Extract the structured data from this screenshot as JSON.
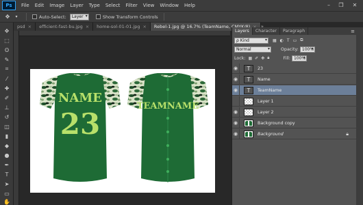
{
  "app": {
    "logo": "Ps"
  },
  "menu": [
    "File",
    "Edit",
    "Image",
    "Layer",
    "Type",
    "Select",
    "Filter",
    "View",
    "Window",
    "Help"
  ],
  "window_controls": {
    "minimize": "–",
    "restore": "❐",
    "close": "✕"
  },
  "options": {
    "auto_select_label": "Auto-Select:",
    "auto_select_value": "Layer",
    "transform_label": "Show Transform Controls"
  },
  "tabs": [
    {
      "label": "psd"
    },
    {
      "label": "efficient-fast-bu.jpg"
    },
    {
      "label": "home-sol-01-01.jpg"
    },
    {
      "label": "Rebel-1.jpg @ 16.7% (TeamName, CMYK/8)"
    }
  ],
  "tab_close": "×",
  "tab_overflow": "»",
  "panel": {
    "tabs": [
      "Layers",
      "Character",
      "Paragraph"
    ],
    "kind_label": "ρ Kind",
    "blend_mode": "Normal",
    "opacity_label": "Opacity:",
    "opacity_value": "100%",
    "lock_label": "Lock:",
    "fill_label": "Fill:",
    "fill_value": "100%",
    "layers": [
      {
        "name": "23",
        "type": "text",
        "visible": true,
        "selected": false
      },
      {
        "name": "Name",
        "type": "text",
        "visible": true,
        "selected": false
      },
      {
        "name": "TeamName",
        "type": "text",
        "visible": true,
        "selected": true
      },
      {
        "name": "Layer 1",
        "type": "pixel",
        "visible": false,
        "selected": false
      },
      {
        "name": "Layer 2",
        "type": "pixel",
        "visible": true,
        "selected": false
      },
      {
        "name": "Background copy",
        "type": "image",
        "visible": true,
        "selected": false
      },
      {
        "name": "Background",
        "type": "image",
        "visible": true,
        "selected": false,
        "locked": true
      }
    ]
  },
  "jersey": {
    "back_name": "NAME",
    "back_number": "23",
    "front_text": "TEAMNAME",
    "body_color": "#1e6b35",
    "text_color": "#b8e06a"
  },
  "colors": {
    "selection": "#6c7f99",
    "panel_bg": "#535353",
    "canvas_bg": "#282828"
  }
}
